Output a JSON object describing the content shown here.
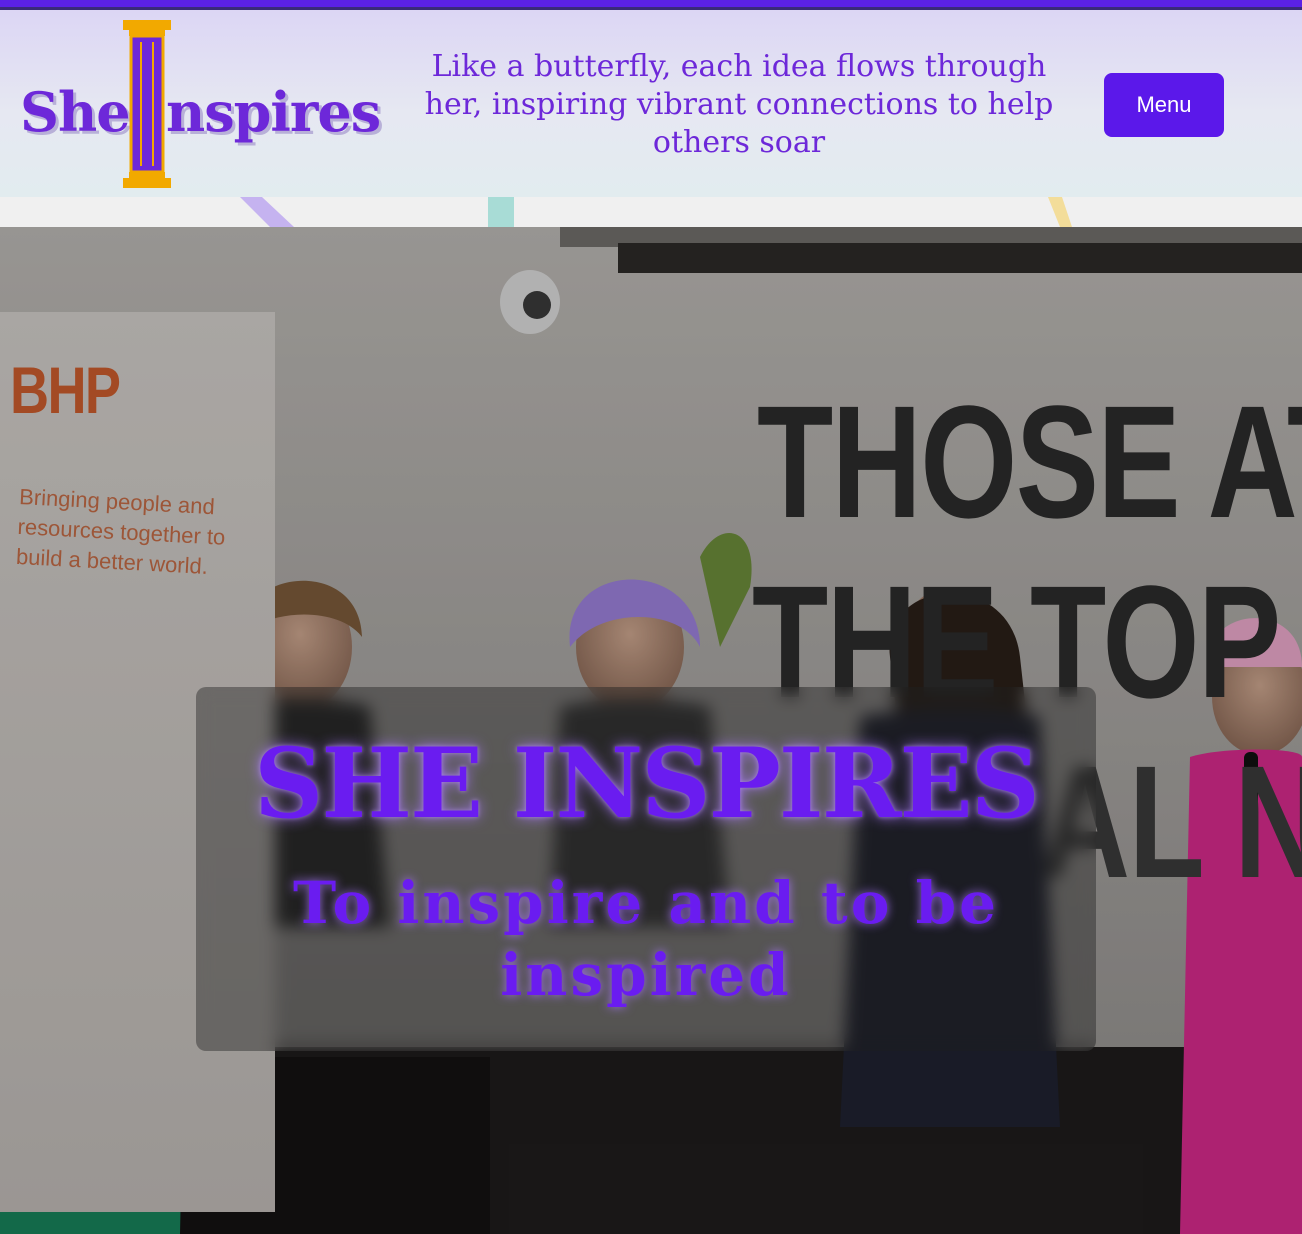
{
  "header": {
    "logo_text_before": "She",
    "logo_text_after": "nspires",
    "tagline": "Like a butterfly, each idea flows through her, inspiring vibrant connections to help others soar",
    "menu_label": "Menu"
  },
  "hero": {
    "photo_signs": {
      "bhp_logo": "BHP",
      "bhp_copy": "Bringing people and resources together to build a better world.",
      "wall_line_1": "THOSE AT",
      "wall_line_2": "THE TOP OF",
      "wall_line_3": "AL NE"
    },
    "title": "SHE INSPIRES",
    "subtitle": "To inspire and to be inspired"
  },
  "colors": {
    "accent": "#5b18ea",
    "brand_purple": "#6d28d9",
    "pillar_gold": "#f2a900"
  },
  "icons": {
    "logo_pillar": "column-pillar-icon"
  }
}
